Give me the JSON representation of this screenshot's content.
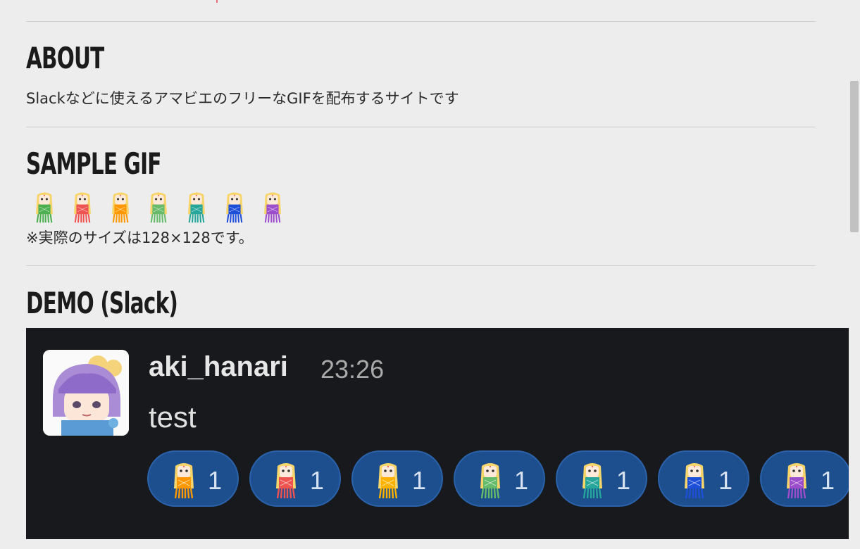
{
  "about": {
    "heading": "ABOUT",
    "description": "Slackなどに使えるアマビエのフリーなGIFを配布するサイトです"
  },
  "sample_gif": {
    "heading": "SAMPLE GIF",
    "colors": [
      "#4caf50",
      "#ef5350",
      "#ff9800",
      "#66bb6a",
      "#26a69a",
      "#1e4fd8",
      "#9c4dcc"
    ],
    "note": "※実際のサイズは128×128です。"
  },
  "demo": {
    "heading": "DEMO (Slack)",
    "username": "aki_hanari",
    "time": "23:26",
    "message": "test",
    "reactions": [
      {
        "color": "#ff9800",
        "count": "1"
      },
      {
        "color": "#ef5350",
        "count": "1"
      },
      {
        "color": "#ffb300",
        "count": "1"
      },
      {
        "color": "#66bb6a",
        "count": "1"
      },
      {
        "color": "#26a69a",
        "count": "1"
      },
      {
        "color": "#1e4fd8",
        "count": "1"
      },
      {
        "color": "#9c4dcc",
        "count": "1"
      }
    ]
  }
}
